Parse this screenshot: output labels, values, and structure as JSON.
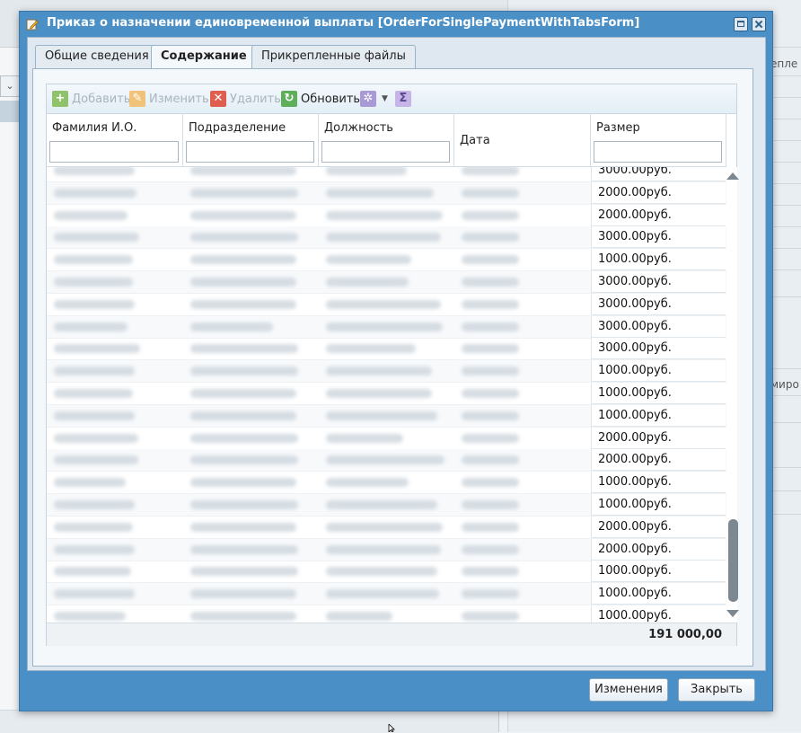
{
  "dialog": {
    "title": "Приказ о назначении единовременной выплаты [OrderForSinglePaymentWithTabsForm]"
  },
  "tabs": [
    "Общие сведения",
    "Содержание",
    "Прикрепленные файлы"
  ],
  "toolbar": {
    "add": "Добавить",
    "edit": "Изменить",
    "delete": "Удалить",
    "refresh": "Обновить"
  },
  "columns": {
    "name": "Фамилия И.О.",
    "department": "Подразделение",
    "position": "Должность",
    "date": "Дата",
    "size": "Размер"
  },
  "rows": [
    {
      "size": "3000.00руб."
    },
    {
      "size": "2000.00руб."
    },
    {
      "size": "2000.00руб."
    },
    {
      "size": "3000.00руб."
    },
    {
      "size": "1000.00руб."
    },
    {
      "size": "3000.00руб."
    },
    {
      "size": "3000.00руб."
    },
    {
      "size": "3000.00руб."
    },
    {
      "size": "3000.00руб."
    },
    {
      "size": "1000.00руб."
    },
    {
      "size": "1000.00руб."
    },
    {
      "size": "1000.00руб."
    },
    {
      "size": "2000.00руб."
    },
    {
      "size": "2000.00руб."
    },
    {
      "size": "1000.00руб."
    },
    {
      "size": "1000.00руб."
    },
    {
      "size": "2000.00руб."
    },
    {
      "size": "2000.00руб."
    },
    {
      "size": "1000.00руб."
    },
    {
      "size": "1000.00руб."
    },
    {
      "size": "1000.00руб."
    }
  ],
  "total": "191 000,00",
  "buttons": {
    "changes": "Изменения",
    "close": "Закрыть"
  },
  "background": {
    "right_text_1": "епле",
    "right_text_2": "миро"
  }
}
